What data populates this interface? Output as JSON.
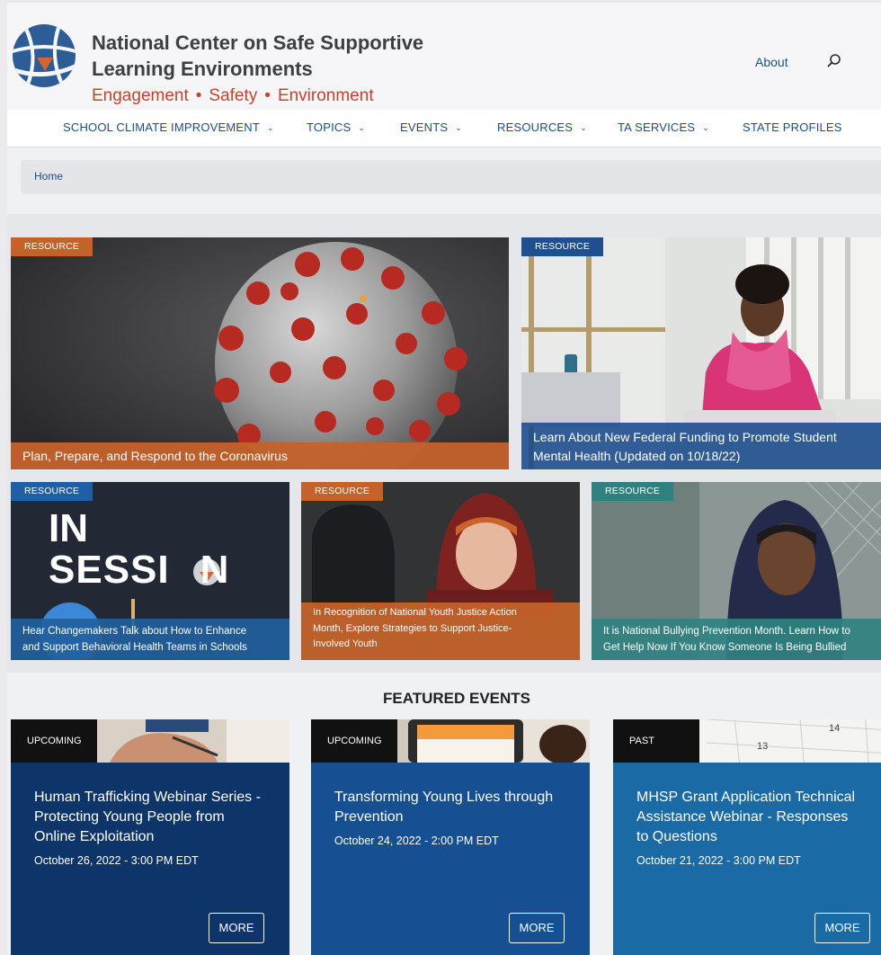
{
  "header": {
    "site_title": "National Center on Safe Supportive Learning Environments",
    "tagline": [
      "Engagement",
      "Safety",
      "Environment"
    ],
    "tagline_separator": "•",
    "about_label": "About",
    "search_icon": "search-icon",
    "logo_icon": "globe-logo"
  },
  "nav": {
    "items": [
      {
        "label": "SCHOOL CLIMATE IMPROVEMENT",
        "has_dropdown": true
      },
      {
        "label": "TOPICS",
        "has_dropdown": true
      },
      {
        "label": "EVENTS",
        "has_dropdown": true
      },
      {
        "label": "RESOURCES",
        "has_dropdown": true
      },
      {
        "label": "TA SERVICES",
        "has_dropdown": true
      },
      {
        "label": "STATE PROFILES",
        "has_dropdown": false
      }
    ],
    "caret": "⌄"
  },
  "breadcrumb": {
    "home": "Home"
  },
  "resources": [
    {
      "badge": "RESOURCE",
      "caption": "Plan, Prepare, and Respond to the Coronavirus"
    },
    {
      "badge": "RESOURCE",
      "caption_lines": [
        "Learn About New Federal Funding to Promote Student",
        "Mental Health (Updated on 10/18/22)"
      ]
    },
    {
      "badge": "RESOURCE",
      "image_text": [
        "IN",
        "SESSI",
        "N"
      ],
      "caption_lines": [
        "Hear Changemakers Talk about How to Enhance",
        "and Support Behavioral Health Teams in Schools"
      ]
    },
    {
      "badge": "RESOURCE",
      "caption_lines": [
        "In Recognition of National Youth Justice Action",
        "Month, Explore Strategies to Support Justice-",
        "Involved Youth"
      ]
    },
    {
      "badge": "RESOURCE",
      "caption_lines": [
        "It is National Bullying Prevention Month. Learn How to",
        "Get Help Now If You Know Someone Is Being Bullied"
      ]
    }
  ],
  "featured": {
    "heading": "FEATURED EVENTS",
    "events": [
      {
        "status": "UPCOMING",
        "title": "Human Trafficking Webinar Series - Protecting Young People from Online Exploitation",
        "date": "October 26, 2022 - 3:00 PM EDT",
        "button": "MORE"
      },
      {
        "status": "UPCOMING",
        "title": "Transforming Young Lives through Prevention",
        "date": "October 24, 2022 - 2:00 PM EDT",
        "button": "MORE"
      },
      {
        "status": "PAST",
        "title": "MHSP Grant Application Technical Assistance Webinar - Responses to Questions",
        "date": "October 21, 2022 - 3:00 PM EDT",
        "button": "MORE",
        "calendar_numbers": [
          "14",
          "13"
        ]
      }
    ]
  },
  "colors": {
    "nav_text": "#1b4e86",
    "tagline": "#c2452a",
    "badge_orange": "#c4622a",
    "badge_blue": "#1f4f8f",
    "badge_teal": "#2f817f",
    "event_dark": "#0e3569",
    "event_mid": "#164f92",
    "event_light": "#1a6aa6"
  }
}
